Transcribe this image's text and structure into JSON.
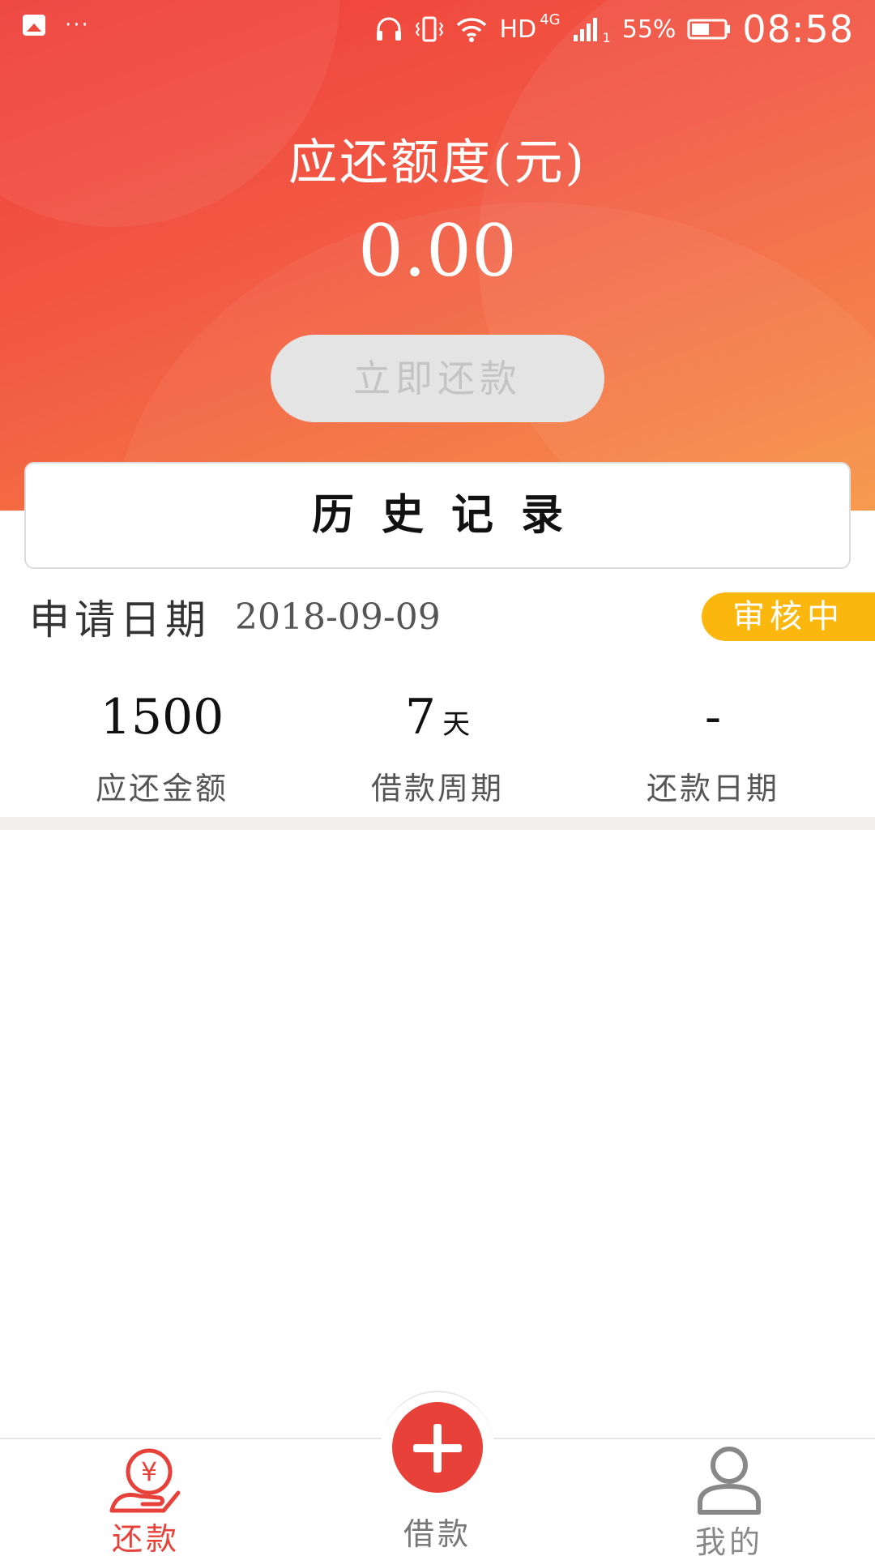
{
  "status_bar": {
    "dots": "···",
    "network": "HD",
    "network_gen": "4G",
    "sim": "1",
    "battery": "55%",
    "time": "08:58",
    "icons": [
      "image-icon",
      "headphones-icon",
      "vibrate-icon",
      "wifi-icon",
      "signal-icon",
      "battery-icon"
    ]
  },
  "hero": {
    "title": "应还额度(元)",
    "amount": "0.00",
    "repay_button": "立即还款"
  },
  "history": {
    "title": "历史记录"
  },
  "record": {
    "date_label": "申请日期",
    "date": "2018-09-09",
    "status": "审核中",
    "amount_value": "1500",
    "amount_label": "应还金额",
    "period_value": "7",
    "period_unit": "天",
    "period_label": "借款周期",
    "repay_date_value": "-",
    "repay_date_label": "还款日期"
  },
  "tabs": {
    "repay": "还款",
    "borrow": "借款",
    "mine": "我的",
    "icons": [
      "yen-hand-icon",
      "plus-icon",
      "user-icon"
    ]
  },
  "colors": {
    "accent": "#e8413a",
    "badge": "#fbb70d",
    "hero_start": "#ef3d39",
    "hero_end": "#f7903a",
    "button_disabled": "#e4e4e4"
  }
}
